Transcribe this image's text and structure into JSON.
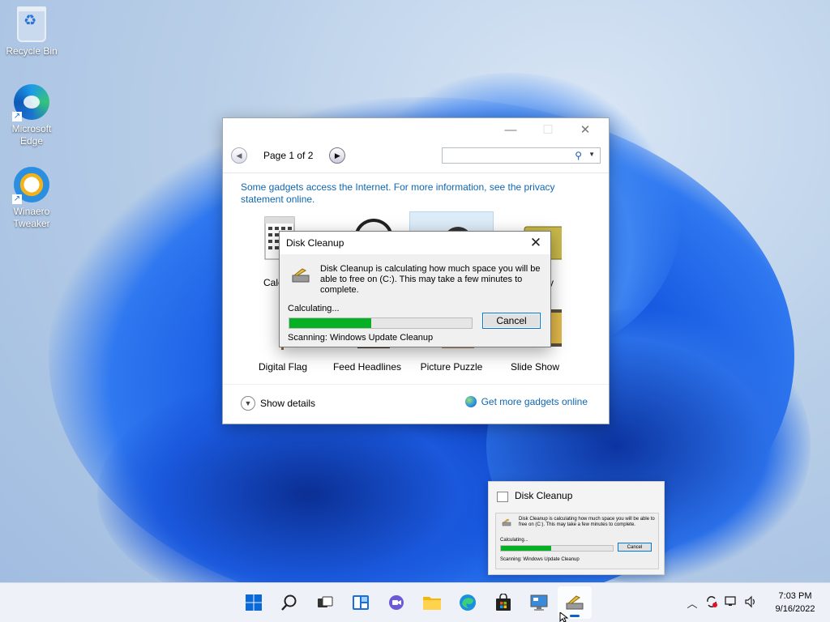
{
  "desktop": {
    "icons": [
      {
        "label": "Recycle Bin"
      },
      {
        "label": "Microsoft Edge"
      },
      {
        "label": "Winaero Tweaker"
      }
    ]
  },
  "gadgets_window": {
    "page_label": "Page 1 of 2",
    "search_placeholder": "",
    "notice": "Some gadgets access the Internet.  For more information, see the privacy statement online.",
    "tiles": [
      "Calendar",
      "Clock",
      "CPU Meter",
      "Currency",
      "Digital Flag",
      "Feed Headlines",
      "Picture Puzzle",
      "Slide Show"
    ],
    "visible_tile_label_fragments": {
      "calendar": "Cale",
      "currency": "y"
    },
    "show_details": "Show details",
    "get_more": "Get more gadgets online"
  },
  "disk_cleanup": {
    "title": "Disk Cleanup",
    "message": "Disk Cleanup is calculating how much space you will be able to free on  (C:). This may take a few minutes to complete.",
    "status": "Calculating...",
    "progress": 0.45,
    "cancel": "Cancel",
    "scanning": "Scanning:   Windows Update Cleanup"
  },
  "taskbar_preview": {
    "title": "Disk Cleanup",
    "message": "Disk Cleanup is calculating how much space you will be able to free on  (C:). This may take a few minutes to complete.",
    "status": "Calculating...",
    "progress": 0.45,
    "cancel": "Cancel",
    "scanning": "Scanning:   Windows Update Cleanup"
  },
  "taskbar": {
    "apps": [
      "start-icon",
      "search-icon",
      "task-view-icon",
      "widgets-icon",
      "chat-icon",
      "file-explorer-icon",
      "edge-icon",
      "store-icon",
      "control-panel-icon",
      "disk-cleanup-icon"
    ],
    "time": "7:03 PM",
    "date": "9/16/2022"
  },
  "colors": {
    "accent": "#0078d7",
    "progress": "#06b025",
    "link": "#0f67b1"
  }
}
